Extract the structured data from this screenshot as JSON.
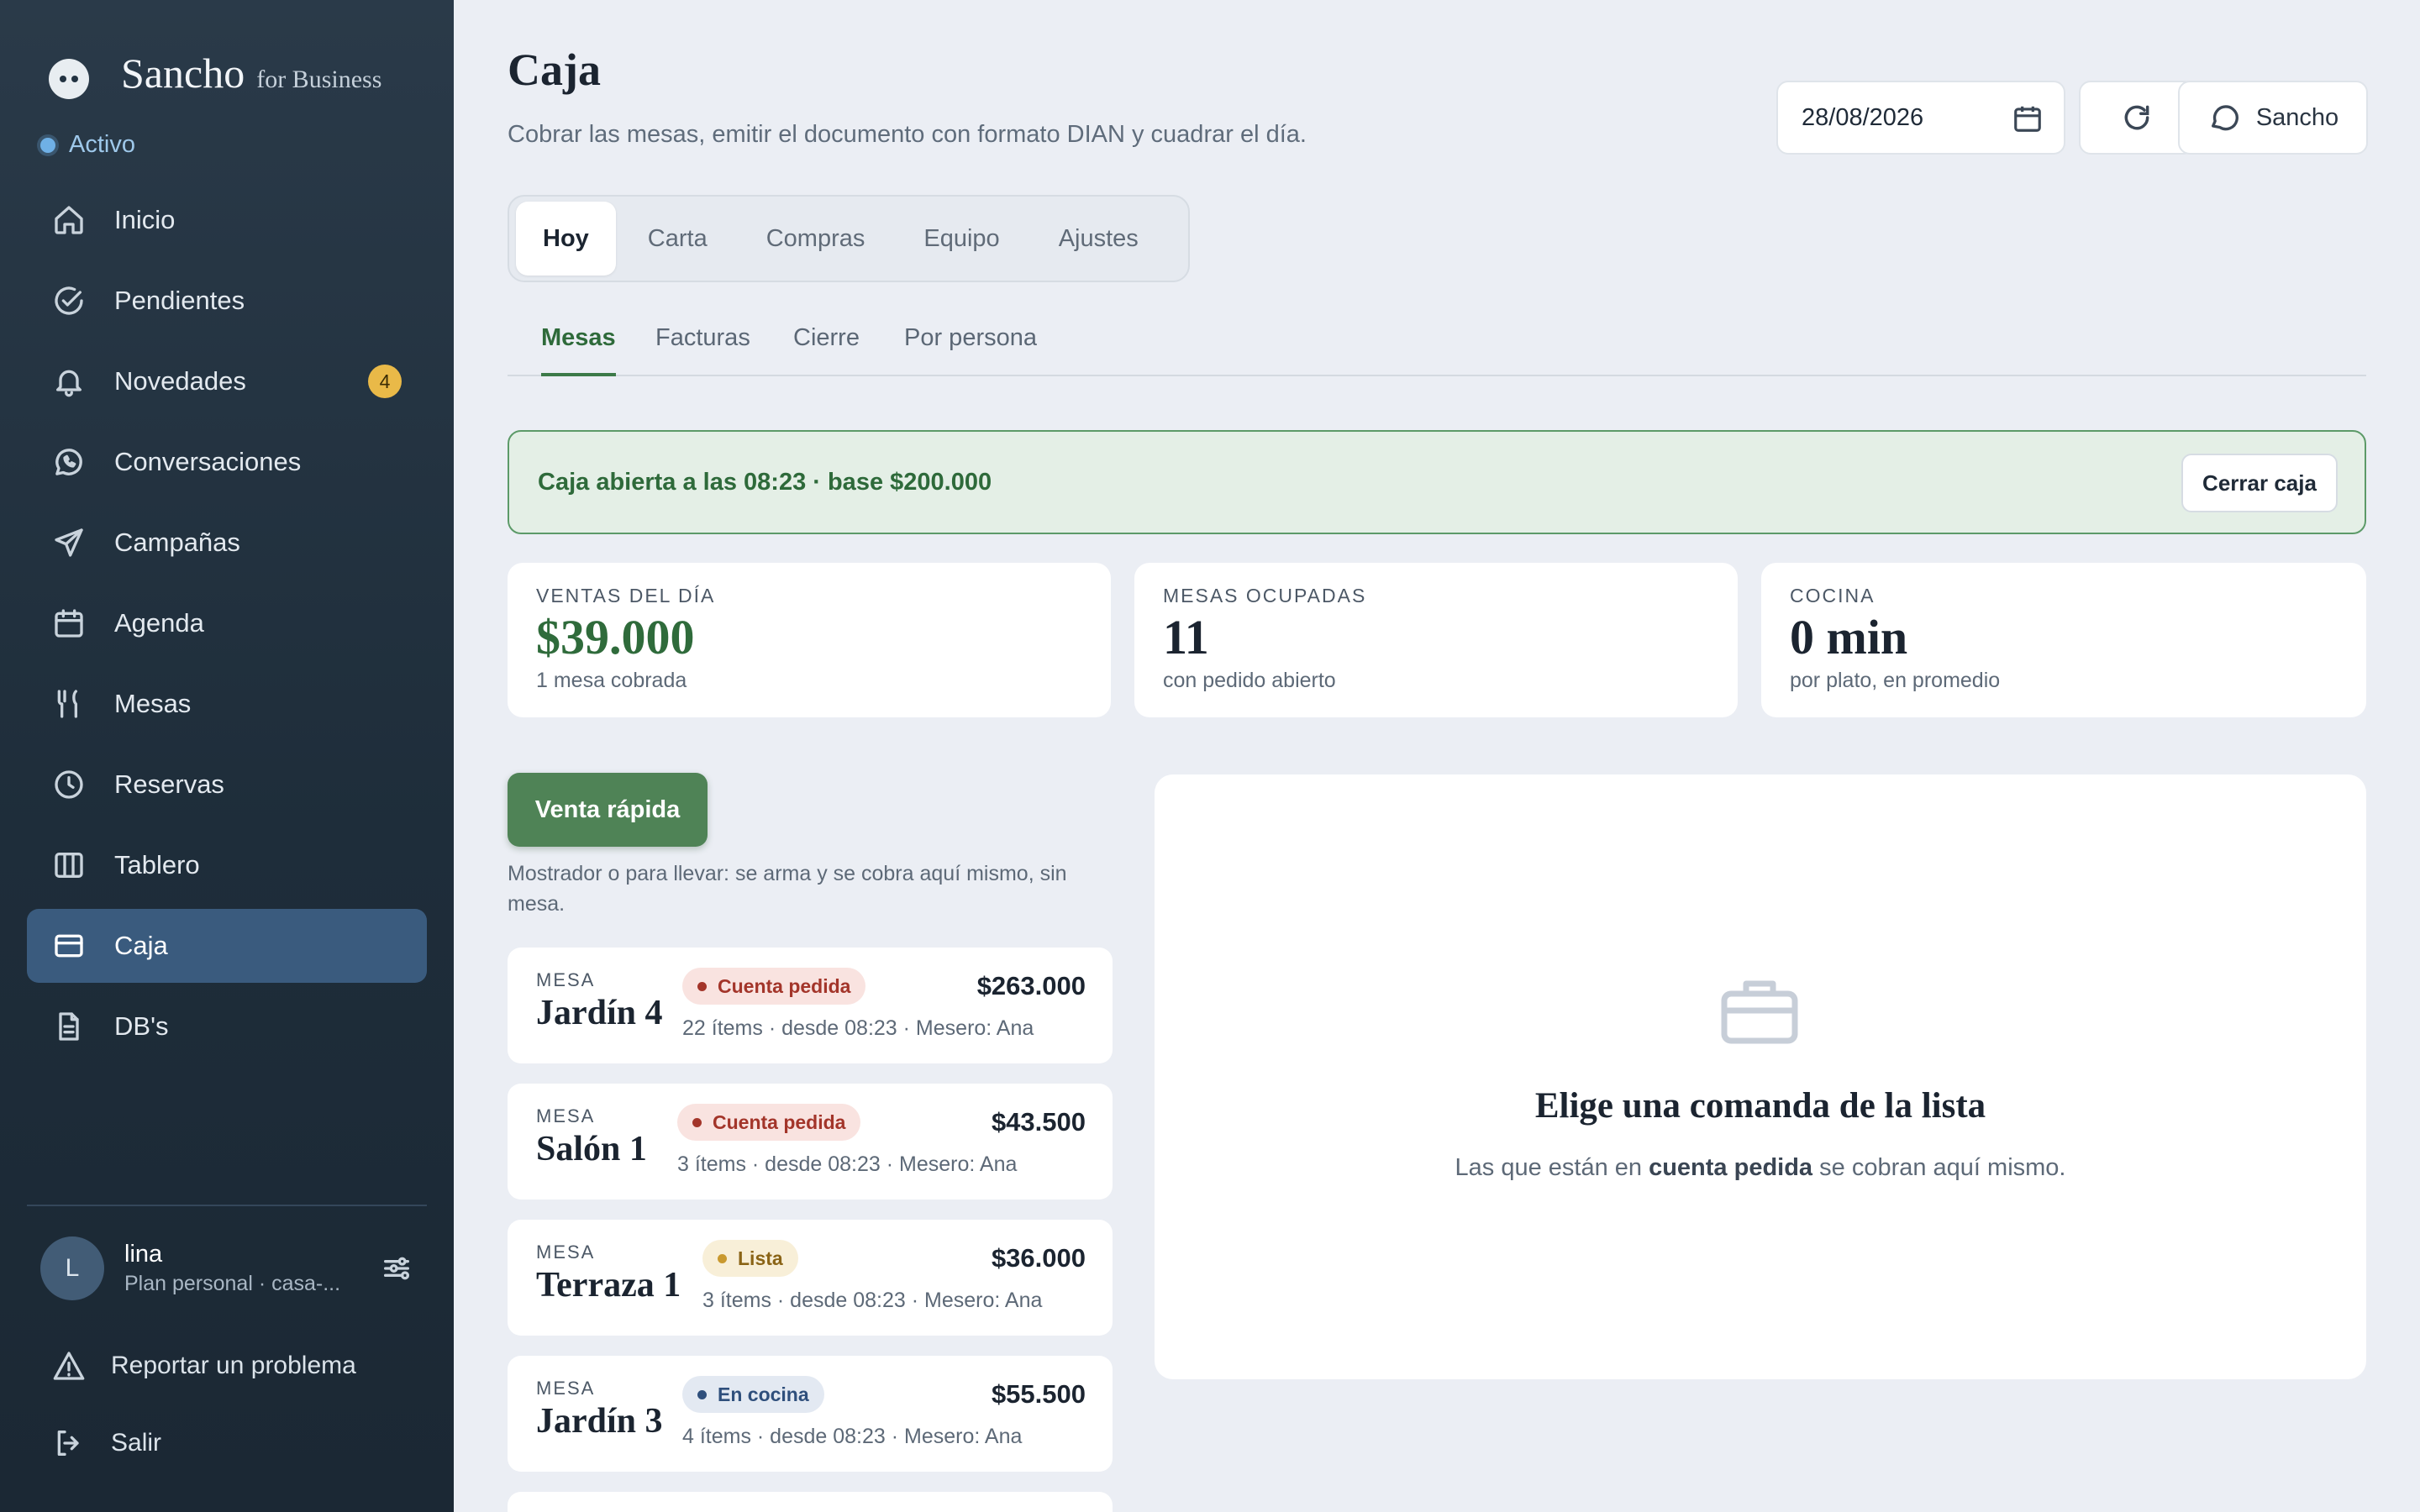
{
  "brand": {
    "name": "Sancho",
    "sub": "for Business"
  },
  "status": {
    "label": "Activo"
  },
  "sidebar": {
    "items": [
      {
        "label": "Inicio",
        "icon": "home-icon"
      },
      {
        "label": "Pendientes",
        "icon": "check-circle-icon"
      },
      {
        "label": "Novedades",
        "icon": "bell-icon",
        "badge": "4"
      },
      {
        "label": "Conversaciones",
        "icon": "whatsapp-icon"
      },
      {
        "label": "Campañas",
        "icon": "send-icon"
      },
      {
        "label": "Agenda",
        "icon": "calendar-icon"
      },
      {
        "label": "Mesas",
        "icon": "utensils-icon"
      },
      {
        "label": "Reservas",
        "icon": "clock-icon"
      },
      {
        "label": "Tablero",
        "icon": "columns-icon"
      },
      {
        "label": "Caja",
        "icon": "credit-card-icon",
        "active": true
      },
      {
        "label": "DB's",
        "icon": "document-icon"
      }
    ],
    "user": {
      "initial": "L",
      "name": "lina",
      "plan": "Plan personal · casa-..."
    },
    "report_label": "Reportar un problema",
    "logout_label": "Salir"
  },
  "header": {
    "title": "Caja",
    "subtitle": "Cobrar las mesas, emitir el documento con formato DIAN y cuadrar el día.",
    "date": "28/08/2026",
    "assistant_label": "Sancho"
  },
  "tabs": [
    "Hoy",
    "Carta",
    "Compras",
    "Equipo",
    "Ajustes"
  ],
  "subtabs": [
    "Mesas",
    "Facturas",
    "Cierre",
    "Por persona"
  ],
  "banner": {
    "text": "Caja abierta a las 08:23 · base $200.000",
    "button": "Cerrar caja"
  },
  "stats": [
    {
      "label": "VENTAS DEL DÍA",
      "value": "$39.000",
      "note": "1 mesa cobrada"
    },
    {
      "label": "MESAS OCUPADAS",
      "value": "11",
      "note": "con pedido abierto"
    },
    {
      "label": "COCINA",
      "value": "0 min",
      "note": "por plato, en promedio"
    }
  ],
  "quick_sale": {
    "button": "Venta rápida",
    "note": "Mostrador o para llevar: se arma y se cobra aquí mismo, sin mesa."
  },
  "orders": [
    {
      "kicker": "MESA",
      "name": "Jardín 4",
      "status": "Cuenta pedida",
      "meta": "22 ítems · desde 08:23 · Mesero: Ana",
      "total": "$263.000"
    },
    {
      "kicker": "MESA",
      "name": "Salón 1",
      "status": "Cuenta pedida",
      "meta": "3 ítems · desde 08:23 · Mesero: Ana",
      "total": "$43.500"
    },
    {
      "kicker": "MESA",
      "name": "Terraza 1",
      "status": "Lista",
      "meta": "3 ítems · desde 08:23 · Mesero: Ana",
      "total": "$36.000"
    },
    {
      "kicker": "MESA",
      "name": "Jardín 3",
      "status": "En cocina",
      "meta": "4 ítems · desde 08:23 · Mesero: Ana",
      "total": "$55.500"
    }
  ],
  "detail": {
    "title": "Elige una comanda de la lista",
    "sub_before": "Las que están en ",
    "sub_bold": "cuenta pedida",
    "sub_after": " se cobran aquí mismo."
  },
  "colors": {
    "sidebar": "#22313f",
    "active_nav": "#3a5b7e",
    "accent_green": "#4f8356",
    "badge": "#e9b948"
  }
}
